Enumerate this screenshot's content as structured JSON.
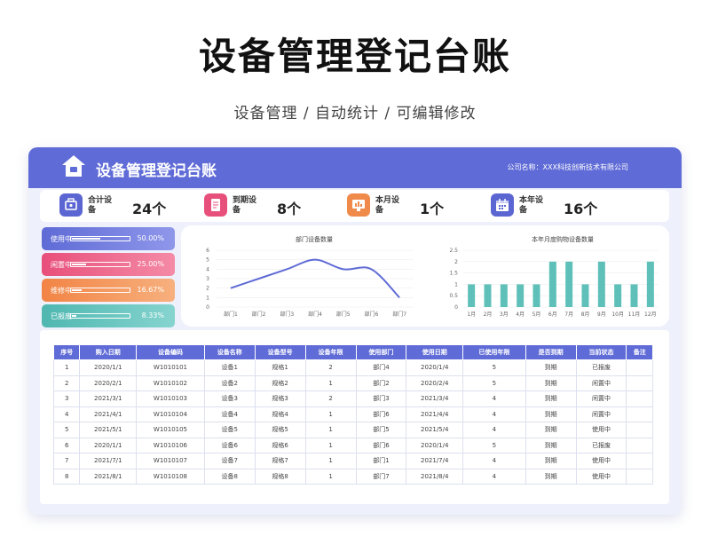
{
  "page": {
    "title": "设备管理登记台账",
    "subtitle": "设备管理 / 自动统计 / 可编辑修改"
  },
  "dashboard": {
    "header": {
      "title": "设备管理登记台账",
      "company": "公司名称：XXX科技创新技术有限公司"
    },
    "stats": [
      {
        "label": "合计设备",
        "value": "24个",
        "icon": "tools-icon",
        "color": "#5c66d2"
      },
      {
        "label": "到期设备",
        "value": "8个",
        "icon": "document-icon",
        "color": "#e8507c"
      },
      {
        "label": "本月设备",
        "value": "1个",
        "icon": "monitor-icon",
        "color": "#f08a4b"
      },
      {
        "label": "本年设备",
        "value": "16个",
        "icon": "calendar-icon",
        "color": "#5c66d2"
      }
    ],
    "statuses": [
      {
        "name": "使用中",
        "percent": "50.00%",
        "fraction": 0.5,
        "color": "#6a76db"
      },
      {
        "name": "闲置中",
        "percent": "25.00%",
        "fraction": 0.25,
        "color": "#ec6a8c"
      },
      {
        "name": "维修中",
        "percent": "16.67%",
        "fraction": 0.1667,
        "color": "#f4955a"
      },
      {
        "name": "已报废",
        "percent": "8.33%",
        "fraction": 0.0833,
        "color": "#5ec0b9"
      }
    ]
  },
  "chart_data": [
    {
      "type": "line",
      "title": "部门设备数量",
      "categories": [
        "部门1",
        "部门2",
        "部门3",
        "部门4",
        "部门5",
        "部门6",
        "部门7"
      ],
      "values": [
        2,
        3,
        4,
        5,
        4,
        4,
        1
      ],
      "ylim": [
        0,
        6
      ],
      "yticks": [
        "0",
        "1",
        "2",
        "3",
        "4",
        "5",
        "6"
      ],
      "color": "#5f6bd6"
    },
    {
      "type": "bar",
      "title": "本年月度购物设备数量",
      "categories": [
        "1月",
        "2月",
        "3月",
        "4月",
        "5月",
        "6月",
        "7月",
        "8月",
        "9月",
        "10月",
        "11月",
        "12月"
      ],
      "values": [
        1,
        1,
        1,
        1,
        1,
        2,
        2,
        1,
        2,
        1,
        1,
        2
      ],
      "ylim": [
        0,
        2.5
      ],
      "yticks": [
        "0",
        "0.5",
        "1",
        "1.5",
        "2",
        "2.5"
      ],
      "color": "#5ec0b9"
    }
  ],
  "table": {
    "headers": [
      "序号",
      "购入日期",
      "设备编码",
      "设备名称",
      "设备型号",
      "设备年限",
      "使用部门",
      "使用日期",
      "已使用年限",
      "是否到期",
      "当前状态",
      "备注"
    ],
    "rows": [
      [
        "1",
        "2020/1/1",
        "W1010101",
        "设备1",
        "规格1",
        "2",
        "部门4",
        "2020/1/4",
        "5",
        "到期",
        "已报废",
        ""
      ],
      [
        "2",
        "2020/2/1",
        "W1010102",
        "设备2",
        "规格2",
        "1",
        "部门2",
        "2020/2/4",
        "5",
        "到期",
        "闲置中",
        ""
      ],
      [
        "3",
        "2021/3/1",
        "W1010103",
        "设备3",
        "规格3",
        "2",
        "部门3",
        "2021/3/4",
        "4",
        "到期",
        "闲置中",
        ""
      ],
      [
        "4",
        "2021/4/1",
        "W1010104",
        "设备4",
        "规格4",
        "1",
        "部门6",
        "2021/4/4",
        "4",
        "到期",
        "闲置中",
        ""
      ],
      [
        "5",
        "2021/5/1",
        "W1010105",
        "设备5",
        "规格5",
        "1",
        "部门5",
        "2021/5/4",
        "4",
        "到期",
        "使用中",
        ""
      ],
      [
        "6",
        "2020/1/1",
        "W1010106",
        "设备6",
        "规格6",
        "1",
        "部门6",
        "2020/1/4",
        "5",
        "到期",
        "已报废",
        ""
      ],
      [
        "7",
        "2021/7/1",
        "W1010107",
        "设备7",
        "规格7",
        "1",
        "部门1",
        "2021/7/4",
        "4",
        "到期",
        "使用中",
        ""
      ],
      [
        "8",
        "2021/8/1",
        "W1010108",
        "设备8",
        "规格8",
        "1",
        "部门7",
        "2021/8/4",
        "4",
        "到期",
        "使用中",
        ""
      ]
    ]
  }
}
